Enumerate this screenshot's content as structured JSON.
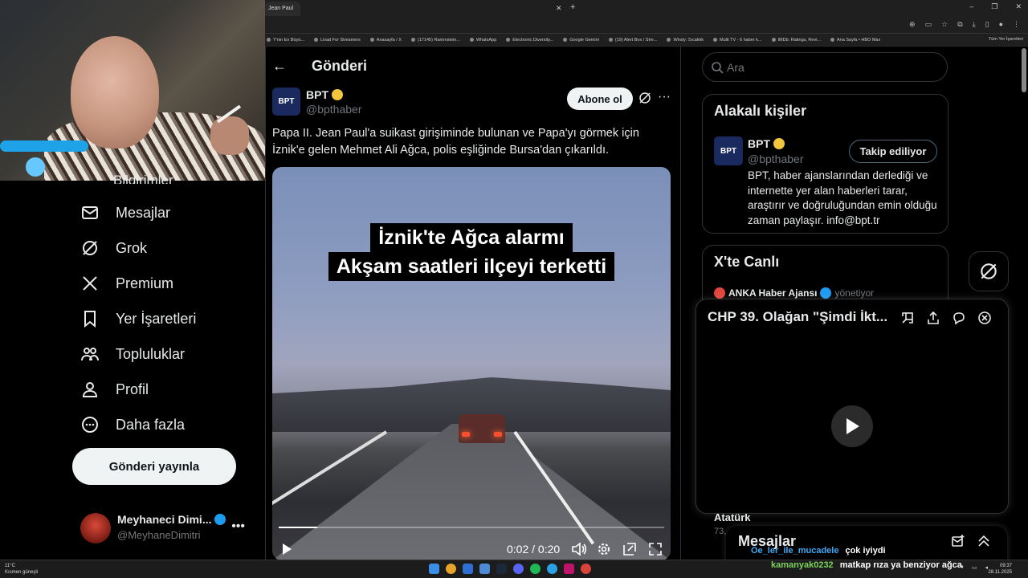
{
  "browser": {
    "tab_title": "Jean Paul",
    "bookmarks": [
      "Y'nin En Büyü...",
      "Livad For Streamers",
      "Anasayfa / X",
      "(17145) Rammstein...",
      "WhatsApp",
      "Electronic Diversity...",
      "Google Gemini",
      "(19) Alert Box / Stre...",
      "Windy: Sıcaklık",
      "Multi TV - 6 haber k...",
      "IMDb: Ratings, Revi...",
      "Ana Sayfa • HBO Max"
    ],
    "bookmarks_right": "Tüm Yer İşaretleri"
  },
  "nav": {
    "partial_item": "Bildirimler",
    "items": [
      {
        "label": "Mesajlar",
        "icon": "mail-icon"
      },
      {
        "label": "Grok",
        "icon": "grok-icon"
      },
      {
        "label": "Premium",
        "icon": "x-logo-icon"
      },
      {
        "label": "Yer İşaretleri",
        "icon": "bookmark-icon"
      },
      {
        "label": "Topluluklar",
        "icon": "communities-icon"
      },
      {
        "label": "Profil",
        "icon": "profile-icon"
      },
      {
        "label": "Daha fazla",
        "icon": "more-circle-icon"
      }
    ],
    "post_button": "Gönderi yayınla",
    "account": {
      "name": "Meyhaneci Dimi...",
      "handle": "@MeyhaneDimitri"
    }
  },
  "main": {
    "title": "Gönderi",
    "post": {
      "name": "BPT",
      "handle": "@bpthaber",
      "avatar_text": "BPT",
      "follow": "Abone ol",
      "text": "Papa II. Jean Paul'a suikast girişiminde bulunan ve Papa'yı görmek için İznik'e gelen Mehmet Ali Ağca, polis eşliğinde Bursa'dan çıkarıldı.",
      "video": {
        "caption_line1": "İznik'te Ağca alarmı",
        "caption_line2": "Akşam saatleri ilçeyi terketti",
        "time": "0:02 / 0:20",
        "progress": 0.1
      }
    }
  },
  "right": {
    "search_placeholder": "Ara",
    "related": {
      "title": "Alakalı kişiler",
      "name": "BPT",
      "handle": "@bpthaber",
      "avatar_text": "BPT",
      "button": "Takip ediliyor",
      "bio": "BPT, haber ajanslarından derlediği ve internette yer alan haberleri tarar, araştırır ve doğruluğundan emin olduğu zaman paylaşır. info@bpt.tr"
    },
    "live": {
      "title": "X'te Canlı",
      "host": "ANKA Haber Ajansı",
      "role": "yönetiyor"
    },
    "mini_player": {
      "title": "CHP 39. Olağan \"Şimdi İkt..."
    },
    "behind_text": "Atatürk",
    "behind_sub": "73,",
    "messages": {
      "title": "Mesajlar"
    }
  },
  "chat": [
    {
      "user": "Oe_ler_ile_mucadele",
      "msg": "çok iyiydi"
    },
    {
      "user": "kamanyak0232",
      "msg": "matkap rıza ya benziyor ağca"
    }
  ],
  "taskbar": {
    "weather": "11°C",
    "weather_desc": "Kısmen güneşli",
    "time": "09:37",
    "date": "28.11.2025"
  },
  "colors": {
    "verified": "#f4c63d",
    "verified_blue": "#1d9bf0",
    "accent": "#eff3f4"
  }
}
